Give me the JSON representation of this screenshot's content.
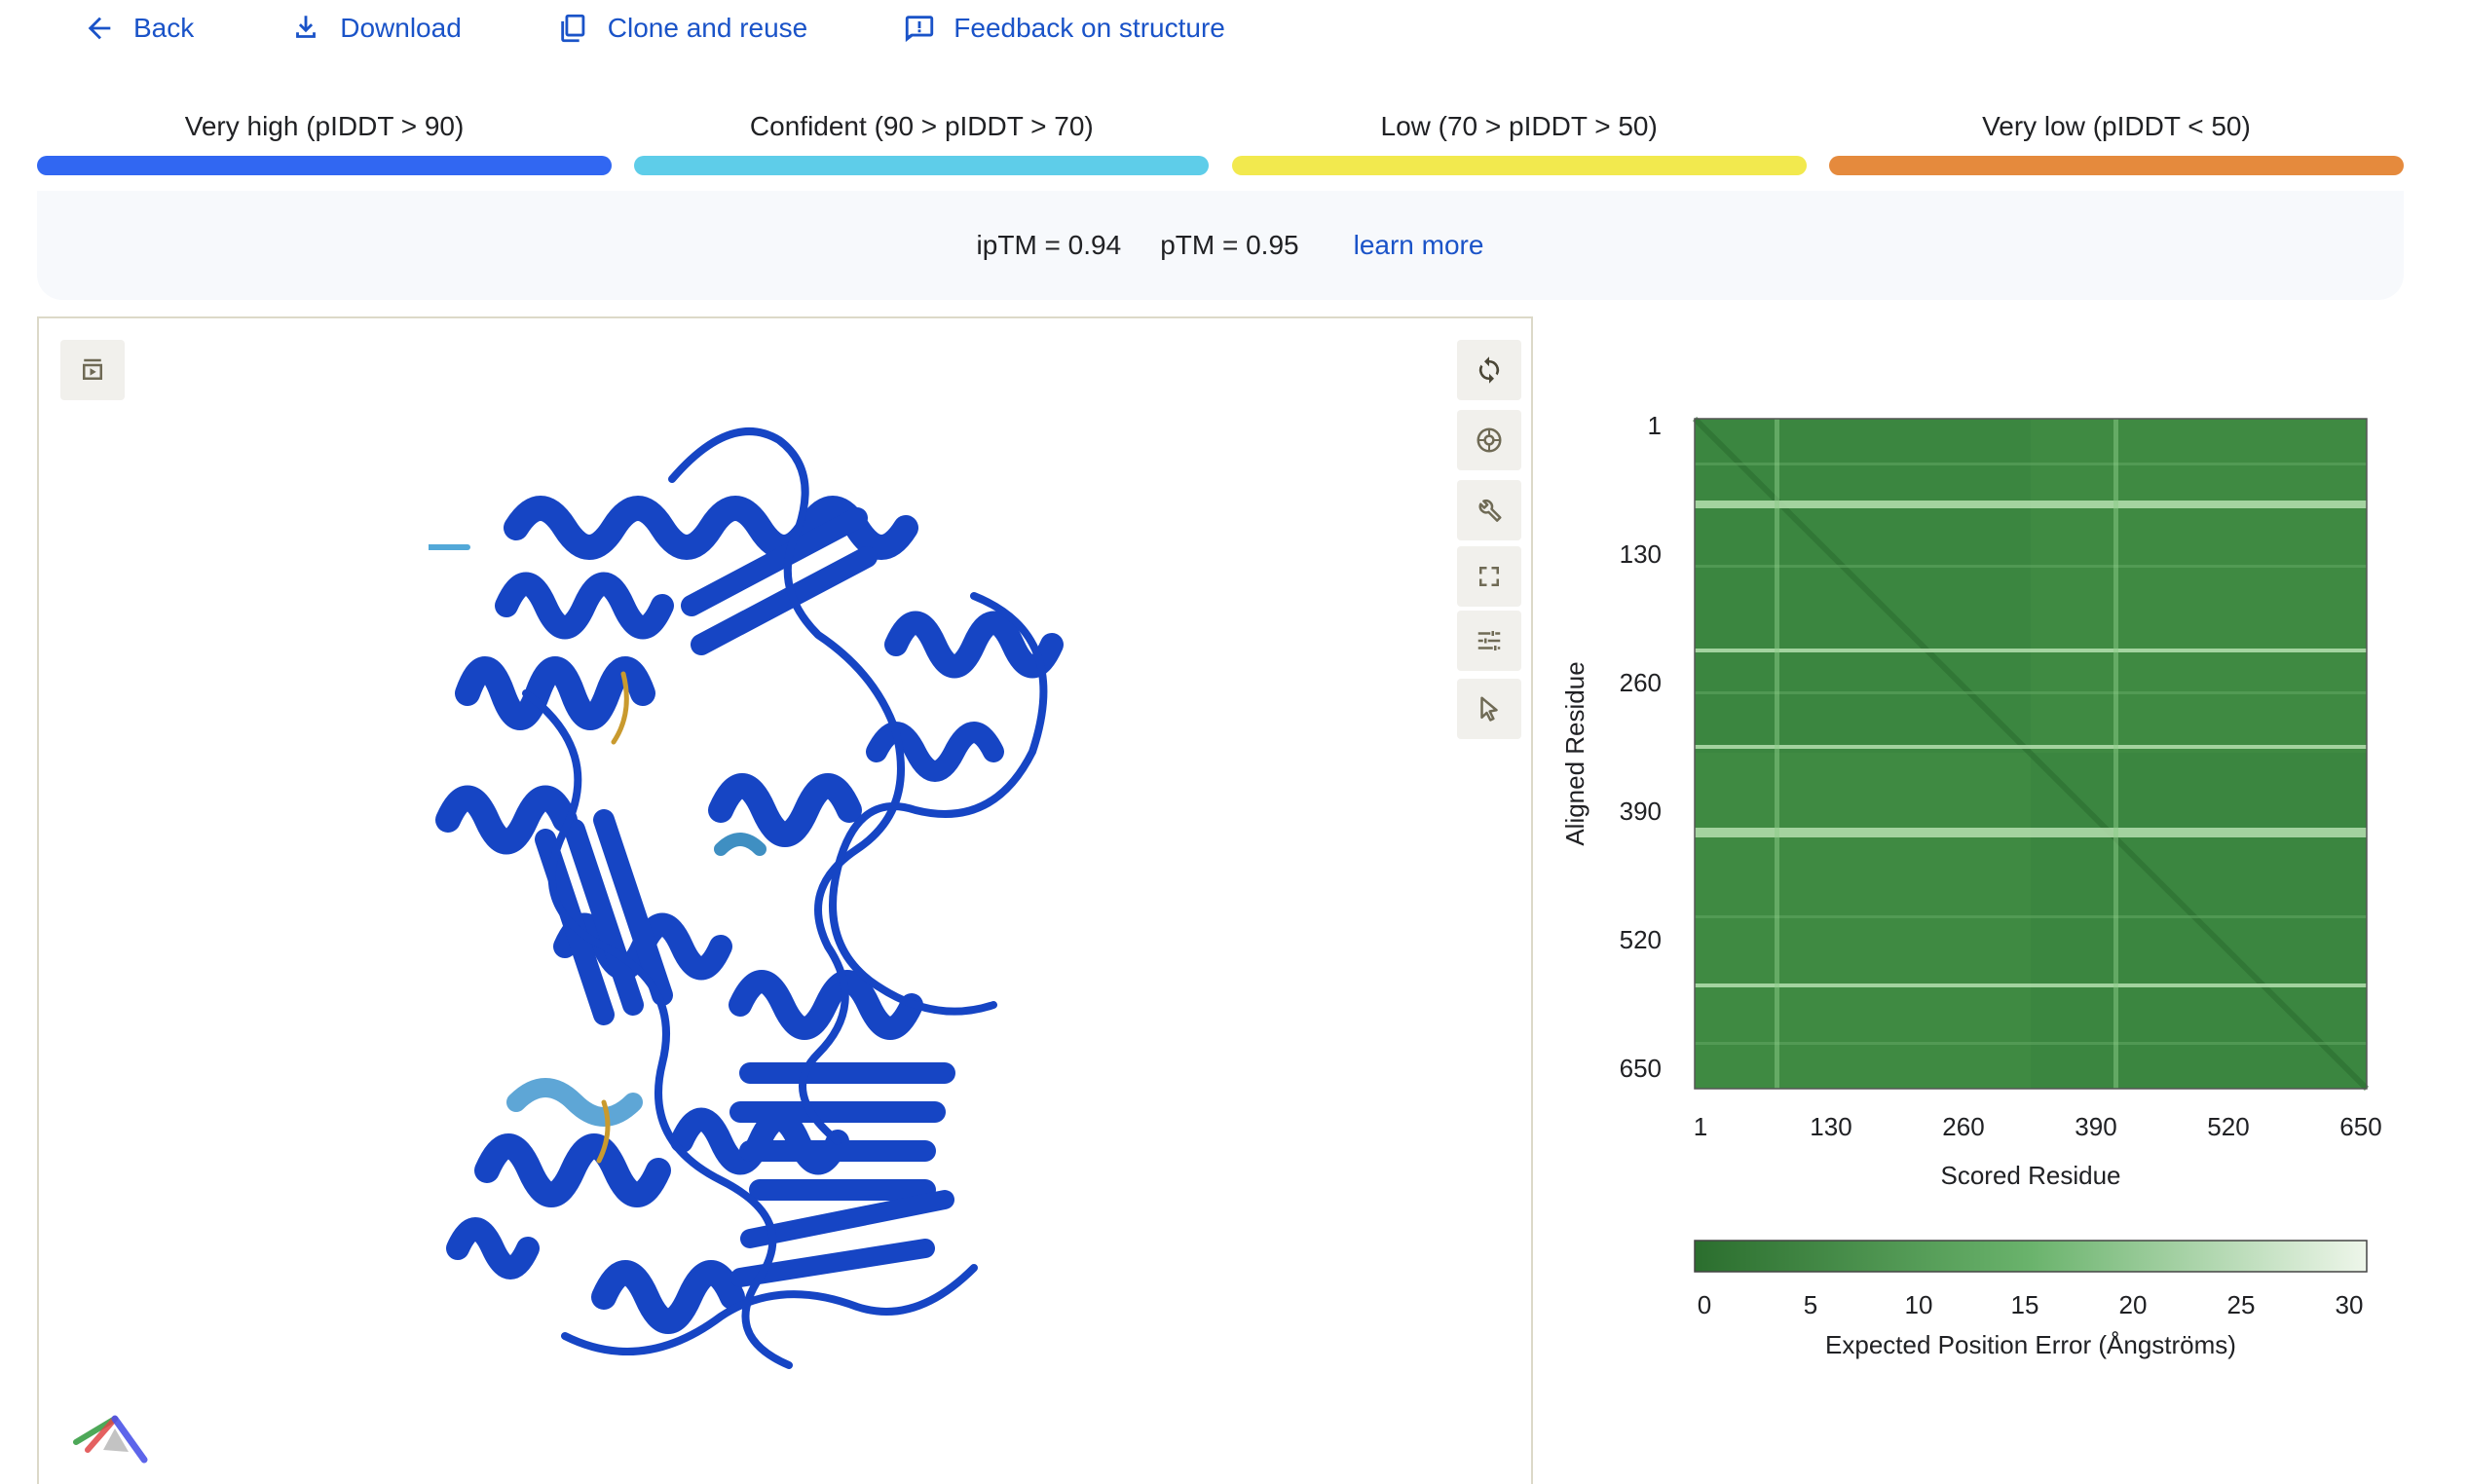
{
  "toolbar": {
    "back": "Back",
    "download": "Download",
    "clone": "Clone and reuse",
    "feedback": "Feedback on structure"
  },
  "legend": [
    {
      "label": "Very high (pIDDT > 90)",
      "color": "#3167f2"
    },
    {
      "label": "Confident (90 > pIDDT > 70)",
      "color": "#5ecde9"
    },
    {
      "label": "Low (70 > pIDDT > 50)",
      "color": "#f2e94e"
    },
    {
      "label": "Very low (pIDDT < 50)",
      "color": "#e58a3d"
    }
  ],
  "metrics": {
    "iptm": "ipTM = 0.94",
    "ptm": "pTM = 0.95",
    "learn_more": "learn more"
  },
  "viewer": {
    "icons": [
      "sequence-play-icon",
      "reset-rotate-icon",
      "camera-icon",
      "wrench-icon",
      "fullscreen-icon",
      "settings-sliders-icon",
      "select-pointer-icon"
    ],
    "protein_color": "#1645c4",
    "axes_indicator_colors": [
      "#2e9a3c",
      "#e04646",
      "#4c55e8"
    ]
  },
  "pae": {
    "ylabel": "Aligned Residue",
    "xlabel": "Scored Residue",
    "ticks": [
      "1",
      "130",
      "260",
      "390",
      "520",
      "650"
    ],
    "colorbar_ticks": [
      "0",
      "5",
      "10",
      "15",
      "20",
      "25",
      "30"
    ],
    "colorbar_label": "Expected Position Error (Ångströms)",
    "colors": {
      "low": "#2b6e2e",
      "mid": "#6ab36c",
      "high": "#eef6ea"
    }
  }
}
